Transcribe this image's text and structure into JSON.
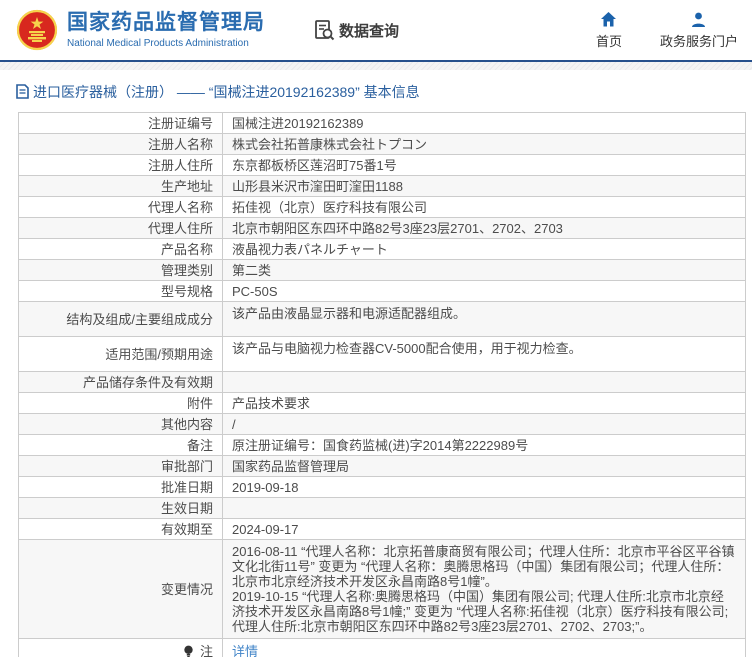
{
  "header": {
    "org_name_cn": "国家药品监督管理局",
    "org_name_en": "National Medical Products Administration",
    "data_query_label": "数据查询",
    "nav": [
      {
        "label": "首页",
        "icon": "home-icon"
      },
      {
        "label": "政务服务门户",
        "icon": "user-icon"
      }
    ]
  },
  "breadcrumb": {
    "text": "进口医疗器械（注册） —— “国械注进20192162389” 基本信息"
  },
  "table": {
    "rows": [
      {
        "label": "注册证编号",
        "value": "国械注进20192162389"
      },
      {
        "label": "注册人名称",
        "value": "株式会社拓普康株式会社トプコン"
      },
      {
        "label": "注册人住所",
        "value": "东京都板桥区莲沼町75番1号"
      },
      {
        "label": "生产地址",
        "value": "山形县米沢市漥田町漥田1188"
      },
      {
        "label": "代理人名称",
        "value": "拓佳视（北京）医疗科技有限公司"
      },
      {
        "label": "代理人住所",
        "value": "北京市朝阳区东四环中路82号3座23层2701、2702、2703"
      },
      {
        "label": "产品名称",
        "value": "液晶视力表パネルチャート"
      },
      {
        "label": "管理类别",
        "value": "第二类"
      },
      {
        "label": "型号规格",
        "value": "PC-50S"
      },
      {
        "label": "结构及组成/主要组成成分",
        "value": "该产品由液晶显示器和电源适配器组成。"
      },
      {
        "label": "适用范围/预期用途",
        "value": "该产品与电脑视力检查器CV-5000配合使用，用于视力检查。"
      },
      {
        "label": "产品储存条件及有效期",
        "value": ""
      },
      {
        "label": "附件",
        "value": "产品技术要求"
      },
      {
        "label": "其他内容",
        "value": "/"
      },
      {
        "label": "备注",
        "value": "原注册证编号：国食药监械(进)字2014第2222989号"
      },
      {
        "label": "审批部门",
        "value": "国家药品监督管理局"
      },
      {
        "label": "批准日期",
        "value": "2019-09-18"
      },
      {
        "label": "生效日期",
        "value": ""
      },
      {
        "label": "有效期至",
        "value": "2024-09-17"
      },
      {
        "label": "变更情况",
        "value": "2016-08-11 “代理人名称：北京拓普康商贸有限公司；代理人住所：北京市平谷区平谷镇文化北街11号” 变更为 “代理人名称：奥腾思格玛（中国）集团有限公司；代理人住所：北京市北京经济技术开发区永昌南路8号1幢”。\n2019-10-15 “代理人名称:奥腾思格玛（中国）集团有限公司; 代理人住所:北京市北京经济技术开发区永昌南路8号1幢;” 变更为 “代理人名称:拓佳视（北京）医疗科技有限公司; 代理人住所:北京市朝阳区东四环中路82号3座23层2701、2702、2703;”。"
      },
      {
        "label": "注",
        "value": "详情",
        "link": true,
        "icon": "note-bulb-icon"
      }
    ]
  },
  "colors": {
    "brand_blue": "#2a6cb0",
    "divider_blue": "#26508c",
    "link_blue": "#4285c8",
    "border": "#cccccc",
    "row_alt_bg": "#f7f7f7",
    "emblem_red": "#d8281e",
    "emblem_gold": "#f6d34c"
  }
}
